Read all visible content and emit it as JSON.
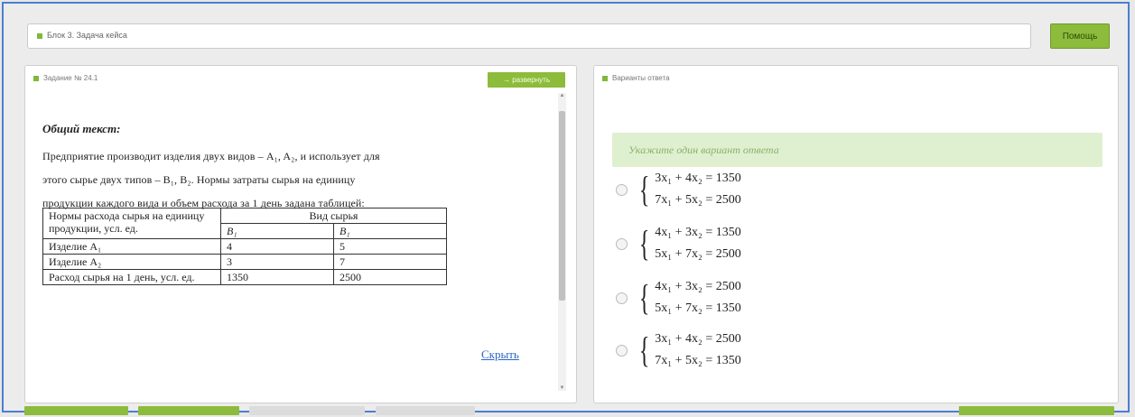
{
  "header": {
    "block_title": "Блок 3. Задача кейса",
    "help_label": "Помощь"
  },
  "task": {
    "title": "Задание № 24.1",
    "expand_label": "развернуть",
    "heading": "Общий текст:",
    "paragraph_lines": [
      "Предприятие производит изделия двух видов – A₁, A₂, и использует для",
      "этого сырье двух типов – B₁, B₂. Нормы затраты сырья на единицу",
      "продукции каждого вида и объем расхода за 1 день задана таблицей:"
    ],
    "table": {
      "header_col1": "Нормы расхода сырья на единицу продукции, усл. ед.",
      "header_group": "Вид сырья",
      "sub1": "B₁",
      "sub2": "B₁",
      "rows": [
        {
          "label": "Изделие A₁",
          "v1": "4",
          "v2": "5"
        },
        {
          "label": "Изделие A₂",
          "v1": "3",
          "v2": "7"
        },
        {
          "label": "Расход сырья на 1 день, усл. ед.",
          "v1": "1350",
          "v2": "2500"
        }
      ]
    },
    "hide_label": "Скрыть"
  },
  "answers": {
    "title": "Варианты ответа",
    "hint": "Укажите один вариант ответа",
    "options": [
      {
        "eq1": "3x₁ + 4x₂ = 1350",
        "eq2": "7x₁ + 5x₂ = 2500"
      },
      {
        "eq1": "4x₁ + 3x₂ = 1350",
        "eq2": "5x₁ + 7x₂ = 2500"
      },
      {
        "eq1": "4x₁ + 3x₂ = 2500",
        "eq2": "5x₁ + 7x₂ = 1350"
      },
      {
        "eq1": "3x₁ + 4x₂ = 2500",
        "eq2": "7x₁ + 5x₂ = 1350"
      }
    ]
  }
}
